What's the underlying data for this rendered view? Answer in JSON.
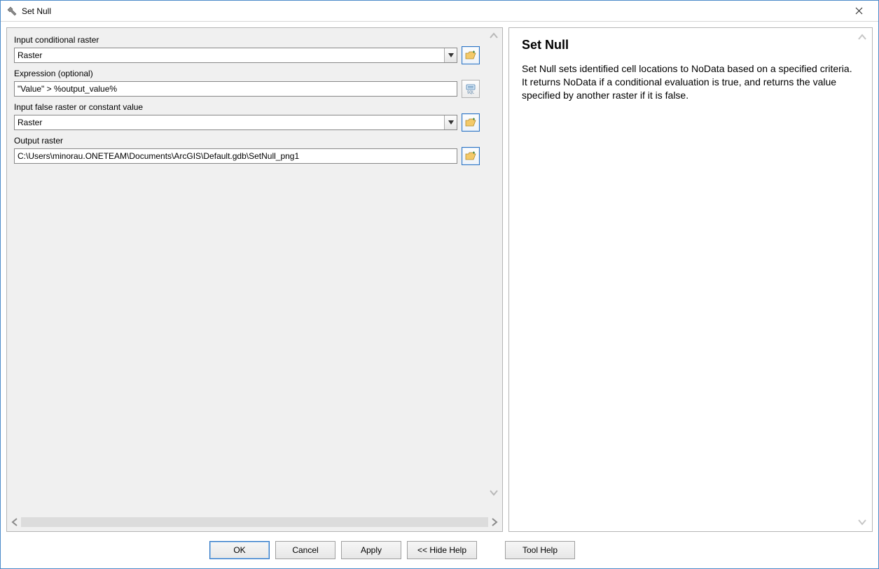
{
  "window": {
    "title": "Set Null"
  },
  "form": {
    "input_conditional_label": "Input conditional raster",
    "input_conditional_value": "Raster",
    "expression_label": "Expression (optional)",
    "expression_value": "\"Value\" > %output_value%",
    "input_false_label": "Input false raster or constant value",
    "input_false_value": "Raster",
    "output_raster_label": "Output raster",
    "output_raster_value": "C:\\Users\\minorau.ONETEAM\\Documents\\ArcGIS\\Default.gdb\\SetNull_png1"
  },
  "help": {
    "title": "Set Null",
    "body": "Set Null sets identified cell locations to NoData based on a specified criteria. It returns NoData if a conditional evaluation is true, and returns the value specified by another raster if it is false."
  },
  "buttons": {
    "ok": "OK",
    "cancel": "Cancel",
    "apply": "Apply",
    "hide_help": "<< Hide Help",
    "tool_help": "Tool Help"
  }
}
